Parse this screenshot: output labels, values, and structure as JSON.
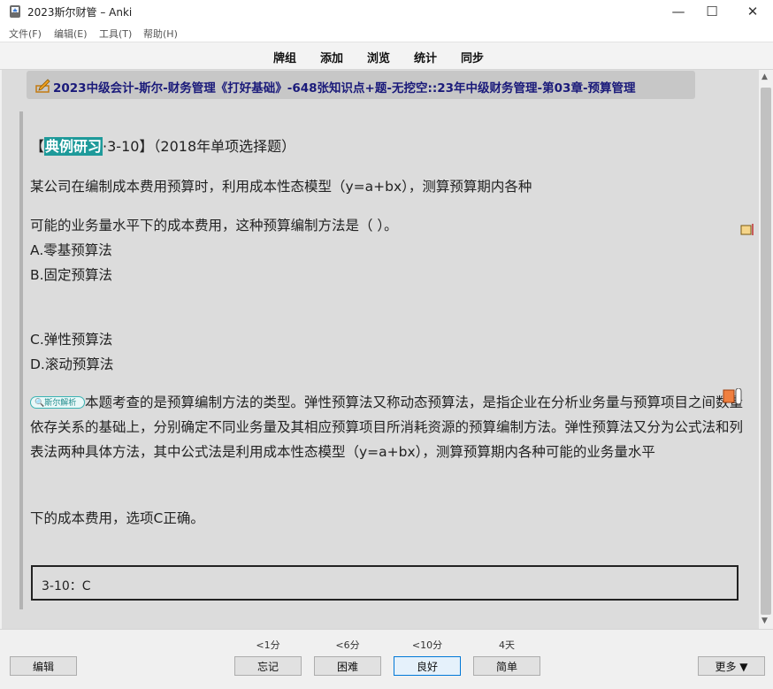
{
  "window": {
    "title": "2023斯尔财管 – Anki",
    "minimize_glyph": "—",
    "maximize_glyph": "☐",
    "close_glyph": "✕"
  },
  "menu": [
    "文件(F)",
    "编辑(E)",
    "工具(T)",
    "帮助(H)"
  ],
  "toolbar": [
    "牌组",
    "添加",
    "浏览",
    "统计",
    "同步"
  ],
  "deck": {
    "icon": "pencil-icon",
    "path": "2023中级会计-斯尔-财务管理《打好基础》-648张知识点+题-无挖空::23年中级财务管理-第03章-预算管理"
  },
  "card": {
    "title_bracket_open": "【",
    "title_tag": "典例研习",
    "title_suffix": "·3-10】（2018年单项选择题）",
    "question_line1": "某公司在编制成本费用预算时，利用成本性态模型（y=a+bx），测算预算期内各种",
    "question_line2": "可能的业务量水平下的成本费用，这种预算编制方法是（ ）。",
    "options": [
      "A.零基预算法",
      "B.固定预算法",
      "C.弹性预算法",
      "D.滚动预算法"
    ],
    "analysis_badge": "斯尔解析",
    "analysis_text": "本题考查的是预算编制方法的类型。弹性预算法又称动态预算法，是指企业在分析业务量与预算项目之间数量依存关系的基础上，分别确定不同业务量及其相应预算项目所消耗资源的预算编制方法。弹性预算法又分为公式法和列表法两种具体方法，其中公式法是利用成本性态模型（y=a+bx），测算预算期内各种可能的业务量水平",
    "analysis_tail": "下的成本费用，选项C正确。",
    "answer": "3-10：C"
  },
  "bottom": {
    "edit_label": "编辑",
    "more_label": "更多 ▼",
    "answers": [
      {
        "interval": "<1分",
        "label": "忘记"
      },
      {
        "interval": "<6分",
        "label": "困难"
      },
      {
        "interval": "<10分",
        "label": "良好"
      },
      {
        "interval": "4天",
        "label": "简单"
      }
    ]
  },
  "colors": {
    "tag_bg": "#1e9a9a",
    "deck_text": "#1a1a7a",
    "content_bg": "#dcdcdc"
  }
}
